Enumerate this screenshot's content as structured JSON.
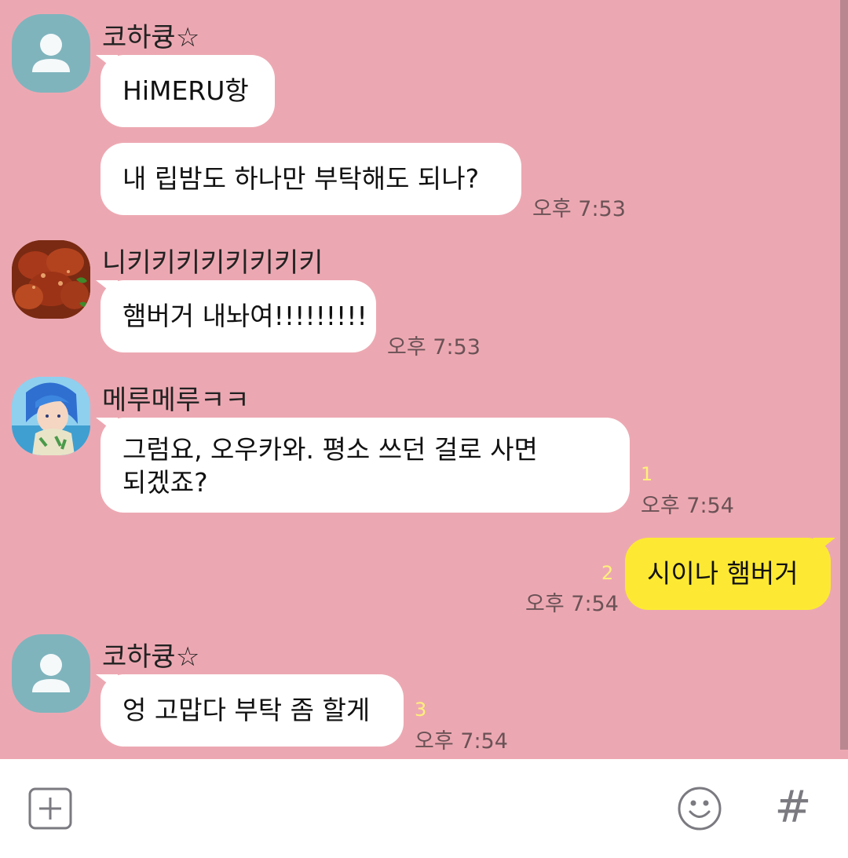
{
  "messages": [
    {
      "sender": "코하큥☆",
      "avatar": "default-profile-icon",
      "lines": [
        "HiMERU항",
        "내 립밤도 하나만 부탁해도 되나?"
      ],
      "time": "오후 7:53"
    },
    {
      "sender": "니키키키키키키키키",
      "avatar": "fried-chicken-photo",
      "lines": [
        "햄버거 내놔여!!!!!!!!!"
      ],
      "time": "오후 7:53"
    },
    {
      "sender": "메루메루ㅋㅋ",
      "avatar": "blue-haired-character-photo",
      "lines": [
        "그럼요, 오우카와. 평소 쓰던 걸로 사면\n되겠죠?"
      ],
      "unread": "1",
      "time": "오후 7:54"
    },
    {
      "sender": "me",
      "lines": [
        "시이나 햄버거"
      ],
      "unread": "2",
      "time": "오후 7:54"
    },
    {
      "sender": "코하큥☆",
      "avatar": "default-profile-icon",
      "lines": [
        "엉 고맙다 부탁 좀 할게"
      ],
      "unread": "3",
      "time": "오후 7:54"
    }
  ],
  "input_bar": {
    "left_icon": "plus-box-icon",
    "right_icons": [
      "emoji-icon",
      "hashtag-icon"
    ],
    "hashtag": "#"
  },
  "colors": {
    "chat_background": "#eca8b2",
    "my_bubble": "#fde933",
    "other_bubble": "#ffffff",
    "unread": "#fff07a"
  }
}
